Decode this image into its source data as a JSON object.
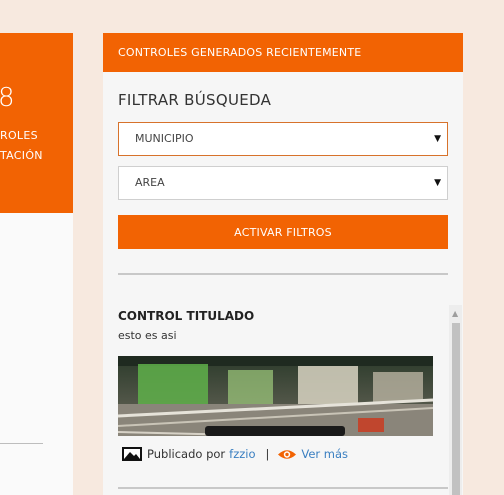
{
  "left_card": {
    "number": "8",
    "line1": "ROLES",
    "line2": "TACIÓN"
  },
  "sidebar": {
    "header": "CONTROLES GENERADOS RECIENTEMENTE",
    "filter_title": "FILTRAR BÚSQUEDA",
    "municipio_select": "MUNICIPIO",
    "area_select": "AREA",
    "activate_button": "ACTIVAR FILTROS"
  },
  "post": {
    "title": "CONTROL TITULADO",
    "excerpt": "esto es asi",
    "published_by": "Publicado por",
    "author": "fzzio",
    "separator": "|",
    "see_more": "Ver más"
  },
  "colors": {
    "accent": "#f26303",
    "link": "#3a7fc1",
    "page_background": "#f7e9df"
  }
}
